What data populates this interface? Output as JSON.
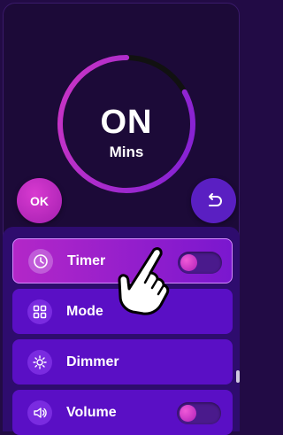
{
  "dial": {
    "status": "ON",
    "unit": "Mins",
    "progress": 0.83
  },
  "controls": {
    "ok_label": "OK",
    "back_icon": "undo-arrow-icon"
  },
  "menu": {
    "items": [
      {
        "label": "Timer",
        "icon": "clock-icon",
        "active": true,
        "toggle": true
      },
      {
        "label": "Mode",
        "icon": "grid-icon",
        "active": false,
        "toggle": false
      },
      {
        "label": "Dimmer",
        "icon": "sun-icon",
        "active": false,
        "toggle": false
      },
      {
        "label": "Volume",
        "icon": "speaker-icon",
        "active": false,
        "toggle": true
      }
    ]
  },
  "colors": {
    "accent": "#c02bd0",
    "panel": "#1c0a38",
    "item": "#5a0fc5",
    "arc_track": "#111111"
  }
}
